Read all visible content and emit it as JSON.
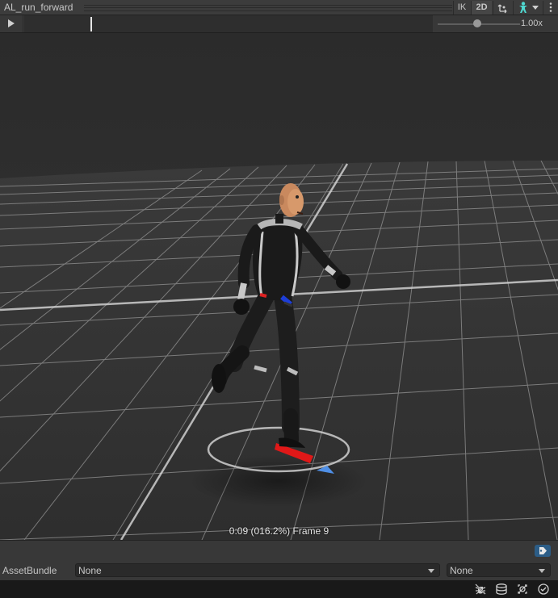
{
  "window": {
    "title": "AL_run_forward"
  },
  "toolbar": {
    "ik_label": "IK",
    "twod_label": "2D"
  },
  "playback": {
    "speed": "1.00x",
    "speed_fraction": 0.45
  },
  "preview": {
    "frame_text": "0:09 (016.2%) Frame 9"
  },
  "assetbundle": {
    "label": "AssetBundle",
    "name_value": "None",
    "variant_value": "None"
  },
  "icons": [
    "pivot-icon",
    "avatar-icon",
    "dropdown-icon",
    "kebab-menu-icon",
    "play-icon",
    "tag-icon",
    "debug-icon",
    "layers-icon",
    "scene-visibility-icon",
    "check-icon"
  ],
  "colors": {
    "accent_blue": "#2c5d87",
    "avatar_teal": "#4fd8d0"
  }
}
